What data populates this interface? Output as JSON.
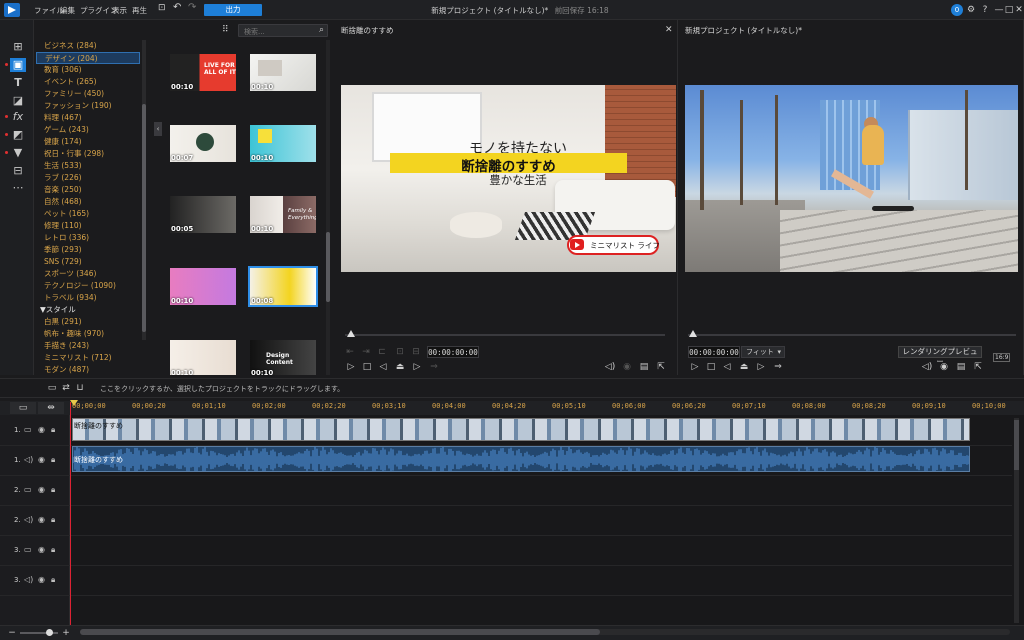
{
  "menu": [
    "ファイル",
    "編集",
    "プラグイン",
    "表示",
    "再生"
  ],
  "output_label": "出力",
  "window_title": "新規プロジェクト (タイトルなし)*",
  "autosave": "前回保存 16:18",
  "notification_count": "0",
  "search": {
    "placeholder": "検索..."
  },
  "categories": [
    {
      "label": "ビジネス (284)"
    },
    {
      "label": "デザイン (204)",
      "selected": true
    },
    {
      "label": "教育 (306)"
    },
    {
      "label": "イベント (265)"
    },
    {
      "label": "ファミリー (450)"
    },
    {
      "label": "ファッション (190)"
    },
    {
      "label": "料理 (467)"
    },
    {
      "label": "ゲーム (243)"
    },
    {
      "label": "健康 (174)"
    },
    {
      "label": "祝日・行事 (298)"
    },
    {
      "label": "生活 (533)"
    },
    {
      "label": "ラブ (226)"
    },
    {
      "label": "音楽 (250)"
    },
    {
      "label": "自然 (468)"
    },
    {
      "label": "ペット (165)"
    },
    {
      "label": "修理 (110)"
    },
    {
      "label": "レトロ (336)"
    },
    {
      "label": "季節 (293)"
    },
    {
      "label": "SNS (729)"
    },
    {
      "label": "スポーツ (346)"
    },
    {
      "label": "テクノロジー (1090)"
    },
    {
      "label": "トラベル (934)"
    }
  ],
  "style_header": "▼スタイル",
  "styles": [
    {
      "label": "白黒 (291)"
    },
    {
      "label": "帆布・趣味 (970)"
    },
    {
      "label": "手描き (243)"
    },
    {
      "label": "ミニマリスト (712)"
    },
    {
      "label": "モダン (487)"
    }
  ],
  "thumbnails": [
    {
      "time": "00:10",
      "bg": "linear-gradient(90deg,#222 0 45%,#e63b2e 45%)",
      "caption": "LIVE FOR ALL OF IT"
    },
    {
      "time": "00:10",
      "bg": "linear-gradient(135deg,#f4f4f2,#d7d7d3)",
      "caption": ""
    },
    {
      "time": "00:07",
      "bg": "linear-gradient(90deg,#f3f1ec,#e7e3dc)",
      "caption": ""
    },
    {
      "time": "00:10",
      "bg": "linear-gradient(90deg,#3cc4d6,#9fe0ea)",
      "caption": ""
    },
    {
      "time": "00:05",
      "bg": "linear-gradient(90deg,#222,#6c6a66)",
      "caption": ""
    },
    {
      "time": "00:10",
      "bg": "linear-gradient(90deg,#d9d4cf,#f1ede8)",
      "caption": ""
    },
    {
      "time": "00:10",
      "bg": "linear-gradient(90deg,#5a4040,#8c6b66)",
      "caption": "Family & Everything"
    },
    {
      "time": "00:10",
      "bg": "linear-gradient(90deg,#e87cc0,#c47ae0)",
      "caption": ""
    },
    {
      "time": "00:08",
      "bg": "linear-gradient(90deg,#f4f1e6,#f3d420 60%,#ffffff)",
      "caption": ""
    },
    {
      "time": "00:10",
      "bg": "linear-gradient(90deg,#f5efe8,#e8ddd2)",
      "caption": ""
    },
    {
      "time": "00:10",
      "bg": "linear-gradient(90deg,#111,#444)",
      "caption": "Design Content"
    }
  ],
  "preview1": {
    "title": "断捨離のすすめ",
    "line1": "モノを持たない",
    "line2": "断捨離のすすめ",
    "line3": "豊かな生活",
    "badge": "ミニマリスト ライフ",
    "timecode": "00:00:00:00"
  },
  "preview2": {
    "title": "新規プロジェクト (タイトルなし)*",
    "timecode": "00:00:00:00",
    "fit": "フィット",
    "render_label": "レンダリングプレビュー",
    "ratio": "16:9"
  },
  "hint": "ここをクリックするか、選択したプロジェクトをトラックにドラッグします。",
  "ruler": [
    "00;00;00",
    "00;00;20",
    "00;01;10",
    "00;02;00",
    "00;02;20",
    "00;03;10",
    "00;04;00",
    "00;04;20",
    "00;05;10",
    "00;06;00",
    "00;06;20",
    "00;07;10",
    "00;08;00",
    "00;08;20",
    "00;09;10",
    "00;10;00"
  ],
  "tracks": [
    {
      "label": "1.",
      "type": "video"
    },
    {
      "label": "1.",
      "type": "audio"
    },
    {
      "label": "2.",
      "type": "video"
    },
    {
      "label": "2.",
      "type": "audio"
    },
    {
      "label": "3.",
      "type": "video"
    },
    {
      "label": "3.",
      "type": "audio"
    }
  ],
  "clips": {
    "video_label": "断捨離のすすめ",
    "audio_label": "断捨離のすすめ"
  }
}
